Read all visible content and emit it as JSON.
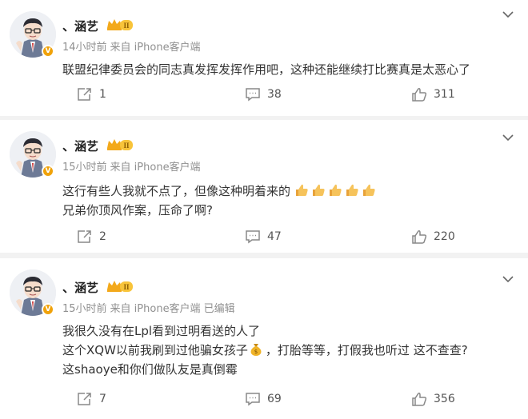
{
  "posts": [
    {
      "username": "、涵艺",
      "level_badge": "II",
      "time": "14小时前",
      "source": "来自 iPhone客户端",
      "edited": "",
      "lines": [
        "联盟纪律委员会的同志真发挥发挥作用吧，这种还能继续打比赛真是太恶心了"
      ],
      "repost_count": "1",
      "comment_count": "38",
      "like_count": "311"
    },
    {
      "username": "、涵艺",
      "level_badge": "II",
      "time": "15小时前",
      "source": "来自 iPhone客户端",
      "edited": "",
      "lines": [
        "这行有些人我就不点了，但像这种明着来的",
        "兄弟你顶风作案，压命了啊?"
      ],
      "emoji_line1": [
        "thumbs-up-icon",
        "thumbs-up-icon",
        "thumbs-up-icon",
        "thumbs-up-icon",
        "thumbs-up-icon"
      ],
      "repost_count": "2",
      "comment_count": "47",
      "like_count": "220"
    },
    {
      "username": "、涵艺",
      "level_badge": "II",
      "time": "15小时前",
      "source": "来自 iPhone客户端",
      "edited": "已编辑",
      "lines": [
        "我很久没有在Lpl看到过明看送的人了",
        "这个XQW以前我刷到过他骗女孩子",
        "，打胎等等，打假我也听过 这不查查?",
        "这shaoye和你们做队友是真倒霉"
      ],
      "inline_emoji": "money-bag-icon",
      "repost_count": "7",
      "comment_count": "69",
      "like_count": "356"
    }
  ],
  "colors": {
    "background": "#f2f2f2",
    "card": "#ffffff",
    "meta_text": "#909090",
    "badge_orange": "#f0a20a"
  }
}
